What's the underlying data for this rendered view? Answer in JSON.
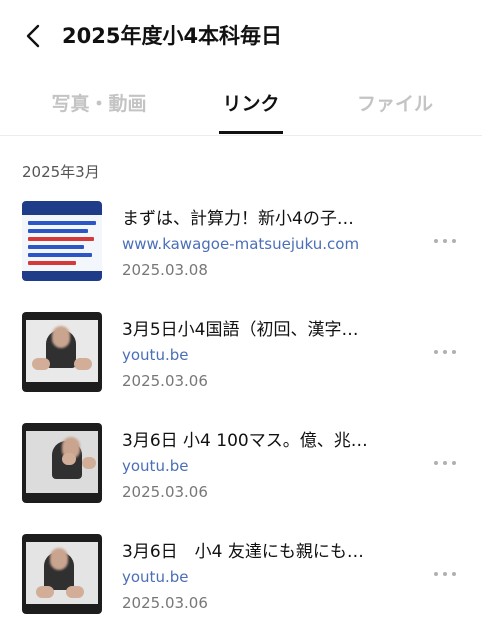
{
  "header": {
    "back_icon": "chevron-left-icon",
    "title": "2025年度小4本科毎日"
  },
  "tabs": [
    {
      "label": "写真・動画",
      "active": false
    },
    {
      "label": "リンク",
      "active": true
    },
    {
      "label": "ファイル",
      "active": false
    }
  ],
  "section": {
    "label": "2025年3月"
  },
  "items": [
    {
      "title": "まずは、計算力！新小4の子…",
      "url": "www.kawagoe-matsuejuku.com",
      "date": "2025.03.08",
      "thumb": "blog"
    },
    {
      "title": "3月5日小4国語（初回、漢字…",
      "url": "youtu.be",
      "date": "2025.03.06",
      "thumb": "video"
    },
    {
      "title": "3月6日 小4 100マス。億、兆…",
      "url": "youtu.be",
      "date": "2025.03.06",
      "thumb": "video"
    },
    {
      "title": "3月6日　小4 友達にも親にも…",
      "url": "youtu.be",
      "date": "2025.03.06",
      "thumb": "video"
    }
  ],
  "colors": {
    "accent_text": "#111111",
    "link": "#4a6fb8",
    "inactive_tab": "#c4c4c4"
  }
}
